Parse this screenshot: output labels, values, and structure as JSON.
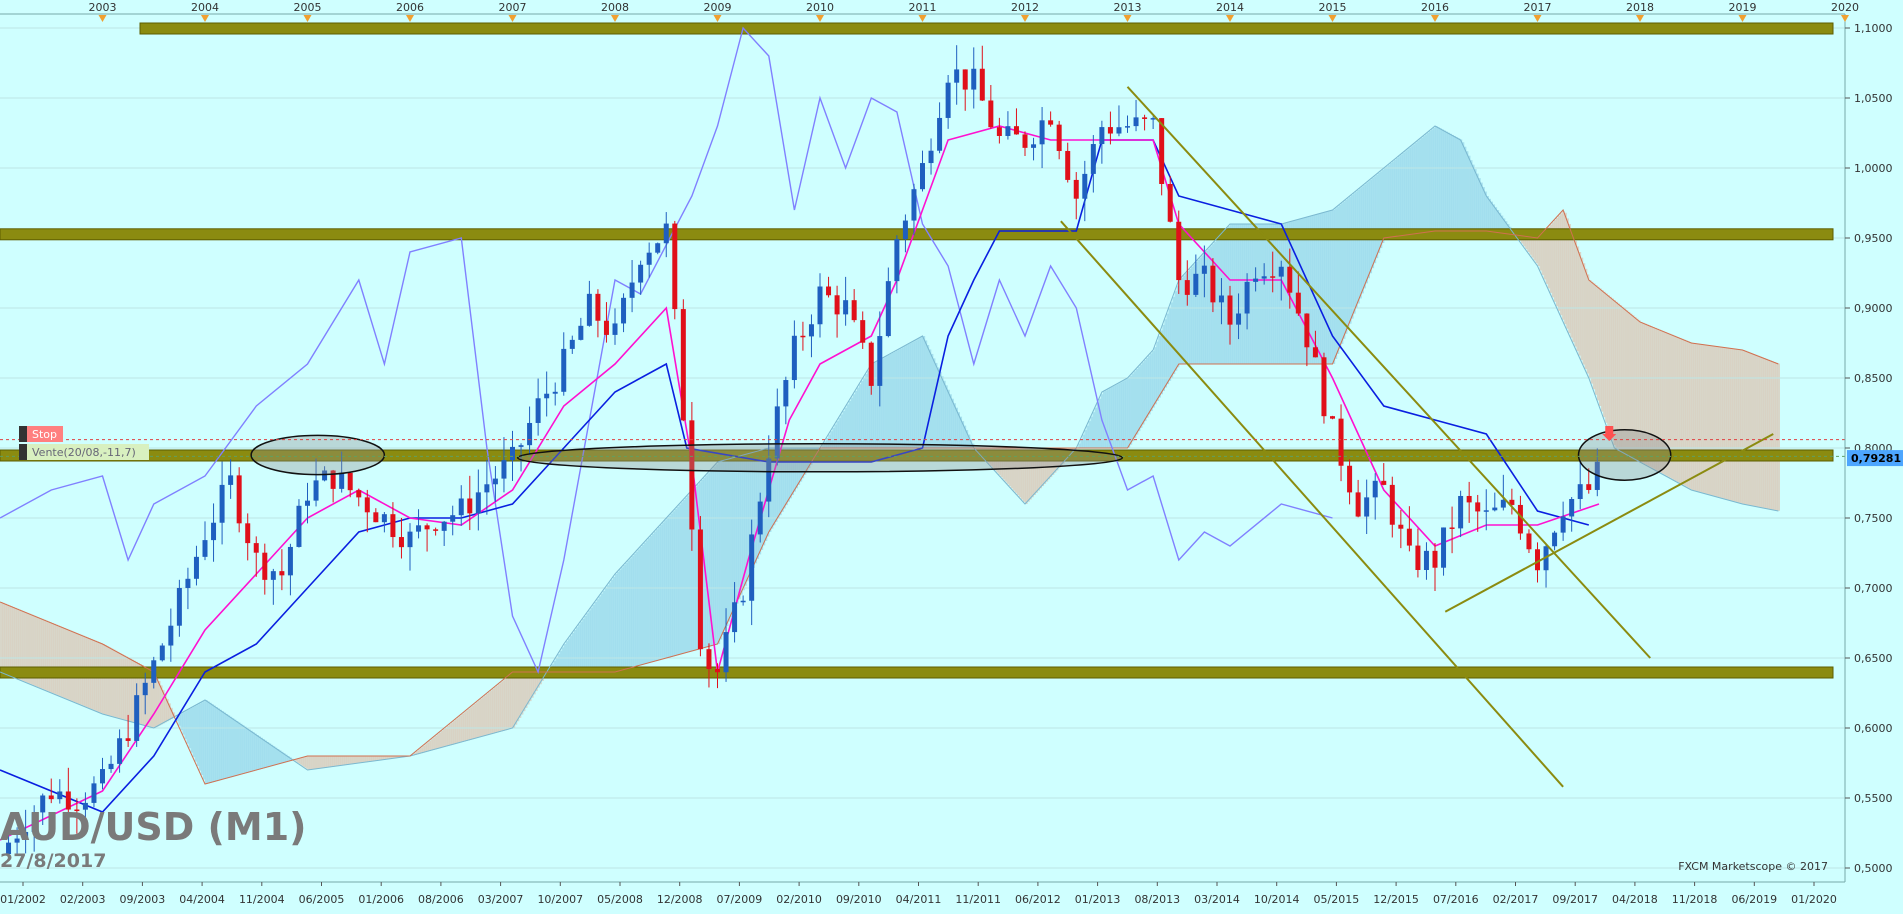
{
  "colors": {
    "background": "#cfffff",
    "bullish": "#1f5fbf",
    "bearish": "#e0101a",
    "band": "#8b8b10",
    "kijun": "#0a1fe0",
    "tenkan": "#ff10d0",
    "chikou": "#8080ff",
    "cloud_bull": "#9fdcec",
    "cloud_bear": "#d9cfc0",
    "trendline": "#8b8b10",
    "price_tag": "#4da6ff"
  },
  "chart_data": {
    "type": "candlestick",
    "instrument": "AUD/USD (M1)",
    "date": "27/8/2017",
    "watermark": "FXCM Marketscope © 2017",
    "y_axis": {
      "range": [
        0.49,
        1.11
      ],
      "ticks": [
        "1,1000",
        "1,0500",
        "1,0000",
        "0,9500",
        "0,9000",
        "0,8500",
        "0,8000",
        "0,7500",
        "0,7000",
        "0,6500",
        "0,6000",
        "0,5500",
        "0,5000"
      ],
      "current_price": "0,79281"
    },
    "top_axis": {
      "years": [
        "2003",
        "2004",
        "2005",
        "2006",
        "2007",
        "2008",
        "2009",
        "2010",
        "2011",
        "2012",
        "2013",
        "2014",
        "2015",
        "2016",
        "2017",
        "2018",
        "2019",
        "2020"
      ]
    },
    "bottom_axis": {
      "dates": [
        "01/2002",
        "02/2003",
        "09/2003",
        "04/2004",
        "11/2004",
        "06/2005",
        "01/2006",
        "08/2006",
        "03/2007",
        "10/2007",
        "05/2008",
        "12/2008",
        "07/2009",
        "02/2010",
        "09/2010",
        "04/2011",
        "11/2011",
        "06/2012",
        "01/2013",
        "08/2013",
        "03/2014",
        "10/2014",
        "05/2015",
        "12/2015",
        "07/2016",
        "02/2017",
        "09/2017",
        "04/2018",
        "11/2018",
        "06/2019",
        "01/2020"
      ]
    },
    "order_labels": {
      "stop": "Stop",
      "sell": "Vente(20/08,-11,7)"
    },
    "horizontal_bands": [
      1.1,
      0.953,
      0.795,
      0.64
    ],
    "trendlines": [
      {
        "x1": 2013.0,
        "y1": 1.058,
        "x2": 2018.1,
        "y2": 0.65
      },
      {
        "x1": 2012.35,
        "y1": 0.962,
        "x2": 2017.25,
        "y2": 0.558
      },
      {
        "x1": 2016.1,
        "y1": 0.683,
        "x2": 2019.3,
        "y2": 0.81
      }
    ],
    "ellipses": [
      {
        "cx": 2005.1,
        "cy": 0.795,
        "rx": 0.65,
        "ry": 0.014
      },
      {
        "cx": 2010.0,
        "cy": 0.793,
        "rx": 2.95,
        "ry": 0.01
      },
      {
        "cx": 2017.85,
        "cy": 0.795,
        "rx": 0.45,
        "ry": 0.018
      }
    ],
    "closes": [
      [
        2002.0,
        0.51
      ],
      [
        2002.25,
        0.535
      ],
      [
        2002.5,
        0.555
      ],
      [
        2002.75,
        0.55
      ],
      [
        2003.0,
        0.56
      ],
      [
        2003.25,
        0.6
      ],
      [
        2003.5,
        0.645
      ],
      [
        2003.75,
        0.69
      ],
      [
        2004.0,
        0.74
      ],
      [
        2004.25,
        0.775
      ],
      [
        2004.5,
        0.72
      ],
      [
        2004.75,
        0.71
      ],
      [
        2005.0,
        0.77
      ],
      [
        2005.25,
        0.78
      ],
      [
        2005.5,
        0.765
      ],
      [
        2005.75,
        0.75
      ],
      [
        2006.0,
        0.735
      ],
      [
        2006.25,
        0.75
      ],
      [
        2006.5,
        0.755
      ],
      [
        2006.75,
        0.775
      ],
      [
        2007.0,
        0.79
      ],
      [
        2007.25,
        0.83
      ],
      [
        2007.5,
        0.86
      ],
      [
        2007.75,
        0.9
      ],
      [
        2008.0,
        0.88
      ],
      [
        2008.25,
        0.94
      ],
      [
        2008.5,
        0.955
      ],
      [
        2008.7,
        0.8
      ],
      [
        2008.85,
        0.65
      ],
      [
        2009.0,
        0.64
      ],
      [
        2009.25,
        0.7
      ],
      [
        2009.5,
        0.8
      ],
      [
        2009.75,
        0.87
      ],
      [
        2010.0,
        0.91
      ],
      [
        2010.25,
        0.9
      ],
      [
        2010.5,
        0.85
      ],
      [
        2010.75,
        0.95
      ],
      [
        2011.0,
        1.0
      ],
      [
        2011.25,
        1.07
      ],
      [
        2011.5,
        1.06
      ],
      [
        2011.75,
        1.02
      ],
      [
        2012.0,
        1.02
      ],
      [
        2012.25,
        1.04
      ],
      [
        2012.5,
        0.98
      ],
      [
        2012.75,
        1.03
      ],
      [
        2013.0,
        1.03
      ],
      [
        2013.25,
        1.03
      ],
      [
        2013.5,
        0.92
      ],
      [
        2013.75,
        0.92
      ],
      [
        2014.0,
        0.89
      ],
      [
        2014.25,
        0.93
      ],
      [
        2014.5,
        0.935
      ],
      [
        2014.75,
        0.88
      ],
      [
        2015.0,
        0.81
      ],
      [
        2015.25,
        0.76
      ],
      [
        2015.5,
        0.77
      ],
      [
        2015.75,
        0.72
      ],
      [
        2016.0,
        0.72
      ],
      [
        2016.25,
        0.76
      ],
      [
        2016.5,
        0.75
      ],
      [
        2016.75,
        0.76
      ],
      [
        2017.0,
        0.72
      ],
      [
        2017.25,
        0.76
      ],
      [
        2017.5,
        0.77
      ],
      [
        2017.65,
        0.79
      ]
    ],
    "tenkan": [
      [
        2002.0,
        0.52
      ],
      [
        2003.0,
        0.555
      ],
      [
        2003.5,
        0.61
      ],
      [
        2004.0,
        0.67
      ],
      [
        2004.5,
        0.71
      ],
      [
        2005.0,
        0.75
      ],
      [
        2005.5,
        0.77
      ],
      [
        2006.0,
        0.75
      ],
      [
        2006.5,
        0.745
      ],
      [
        2007.0,
        0.77
      ],
      [
        2007.5,
        0.83
      ],
      [
        2008.0,
        0.86
      ],
      [
        2008.5,
        0.9
      ],
      [
        2008.75,
        0.79
      ],
      [
        2009.0,
        0.64
      ],
      [
        2009.3,
        0.72
      ],
      [
        2009.7,
        0.82
      ],
      [
        2010.0,
        0.86
      ],
      [
        2010.5,
        0.88
      ],
      [
        2010.75,
        0.92
      ],
      [
        2011.0,
        0.97
      ],
      [
        2011.25,
        1.02
      ],
      [
        2011.75,
        1.03
      ],
      [
        2012.25,
        1.02
      ],
      [
        2012.75,
        1.02
      ],
      [
        2013.25,
        1.02
      ],
      [
        2013.5,
        0.96
      ],
      [
        2014.0,
        0.92
      ],
      [
        2014.5,
        0.92
      ],
      [
        2015.0,
        0.85
      ],
      [
        2015.5,
        0.77
      ],
      [
        2016.0,
        0.73
      ],
      [
        2016.5,
        0.745
      ],
      [
        2017.0,
        0.745
      ],
      [
        2017.6,
        0.76
      ]
    ],
    "kijun": [
      [
        2002.0,
        0.57
      ],
      [
        2003.0,
        0.54
      ],
      [
        2003.5,
        0.58
      ],
      [
        2004.0,
        0.64
      ],
      [
        2004.5,
        0.66
      ],
      [
        2005.0,
        0.7
      ],
      [
        2005.5,
        0.74
      ],
      [
        2006.0,
        0.75
      ],
      [
        2006.5,
        0.75
      ],
      [
        2007.0,
        0.76
      ],
      [
        2007.5,
        0.8
      ],
      [
        2008.0,
        0.84
      ],
      [
        2008.5,
        0.86
      ],
      [
        2008.7,
        0.8
      ],
      [
        2009.5,
        0.79
      ],
      [
        2010.0,
        0.79
      ],
      [
        2010.5,
        0.79
      ],
      [
        2011.0,
        0.8
      ],
      [
        2011.25,
        0.88
      ],
      [
        2011.5,
        0.92
      ],
      [
        2011.75,
        0.955
      ],
      [
        2012.5,
        0.955
      ],
      [
        2012.75,
        1.02
      ],
      [
        2013.25,
        1.02
      ],
      [
        2013.5,
        0.98
      ],
      [
        2014.0,
        0.97
      ],
      [
        2014.5,
        0.96
      ],
      [
        2015.0,
        0.88
      ],
      [
        2015.5,
        0.83
      ],
      [
        2016.0,
        0.82
      ],
      [
        2016.5,
        0.81
      ],
      [
        2017.0,
        0.755
      ],
      [
        2017.5,
        0.745
      ]
    ],
    "chikou": [
      [
        2002.0,
        0.75
      ],
      [
        2002.5,
        0.77
      ],
      [
        2003.0,
        0.78
      ],
      [
        2003.25,
        0.72
      ],
      [
        2003.5,
        0.76
      ],
      [
        2004.0,
        0.78
      ],
      [
        2004.5,
        0.83
      ],
      [
        2005.0,
        0.86
      ],
      [
        2005.5,
        0.92
      ],
      [
        2005.75,
        0.86
      ],
      [
        2006.0,
        0.94
      ],
      [
        2006.5,
        0.95
      ],
      [
        2006.75,
        0.8
      ],
      [
        2007.0,
        0.68
      ],
      [
        2007.25,
        0.64
      ],
      [
        2007.5,
        0.72
      ],
      [
        2007.75,
        0.82
      ],
      [
        2008.0,
        0.92
      ],
      [
        2008.25,
        0.91
      ],
      [
        2008.75,
        0.98
      ],
      [
        2009.0,
        1.03
      ],
      [
        2009.25,
        1.1
      ],
      [
        2009.5,
        1.08
      ],
      [
        2009.75,
        0.97
      ],
      [
        2010.0,
        1.05
      ],
      [
        2010.25,
        1.0
      ],
      [
        2010.5,
        1.05
      ],
      [
        2010.75,
        1.04
      ],
      [
        2011.0,
        0.96
      ],
      [
        2011.25,
        0.93
      ],
      [
        2011.5,
        0.86
      ],
      [
        2011.75,
        0.92
      ],
      [
        2012.0,
        0.88
      ],
      [
        2012.25,
        0.93
      ],
      [
        2012.5,
        0.9
      ],
      [
        2012.75,
        0.82
      ],
      [
        2013.0,
        0.77
      ],
      [
        2013.25,
        0.78
      ],
      [
        2013.5,
        0.72
      ],
      [
        2013.75,
        0.74
      ],
      [
        2014.0,
        0.73
      ],
      [
        2014.5,
        0.76
      ],
      [
        2015.0,
        0.75
      ]
    ],
    "senkou_a": [
      [
        2002.0,
        0.64
      ],
      [
        2003.0,
        0.61
      ],
      [
        2003.5,
        0.6
      ],
      [
        2004.0,
        0.62
      ],
      [
        2005.0,
        0.57
      ],
      [
        2006.0,
        0.58
      ],
      [
        2007.0,
        0.6
      ],
      [
        2007.5,
        0.66
      ],
      [
        2008.0,
        0.71
      ],
      [
        2008.5,
        0.75
      ],
      [
        2009.0,
        0.79
      ],
      [
        2009.5,
        0.8
      ],
      [
        2010.0,
        0.8
      ],
      [
        2010.5,
        0.86
      ],
      [
        2011.0,
        0.88
      ],
      [
        2011.5,
        0.8
      ],
      [
        2012.0,
        0.76
      ],
      [
        2012.5,
        0.8
      ],
      [
        2012.75,
        0.84
      ],
      [
        2013.0,
        0.85
      ],
      [
        2013.25,
        0.87
      ],
      [
        2013.5,
        0.92
      ],
      [
        2014.0,
        0.96
      ],
      [
        2014.5,
        0.96
      ],
      [
        2015.0,
        0.97
      ],
      [
        2015.5,
        1.0
      ],
      [
        2016.0,
        1.03
      ],
      [
        2016.25,
        1.02
      ],
      [
        2016.5,
        0.98
      ],
      [
        2017.0,
        0.93
      ],
      [
        2017.5,
        0.85
      ],
      [
        2017.75,
        0.8
      ],
      [
        2018.0,
        0.79
      ],
      [
        2018.5,
        0.77
      ],
      [
        2019.0,
        0.76
      ],
      [
        2019.35,
        0.755
      ]
    ],
    "senkou_b": [
      [
        2002.0,
        0.69
      ],
      [
        2003.0,
        0.66
      ],
      [
        2003.5,
        0.64
      ],
      [
        2004.0,
        0.56
      ],
      [
        2005.0,
        0.58
      ],
      [
        2006.0,
        0.58
      ],
      [
        2007.0,
        0.64
      ],
      [
        2008.0,
        0.64
      ],
      [
        2008.5,
        0.65
      ],
      [
        2009.0,
        0.66
      ],
      [
        2009.5,
        0.74
      ],
      [
        2010.0,
        0.8
      ],
      [
        2010.5,
        0.8
      ],
      [
        2011.0,
        0.8
      ],
      [
        2011.5,
        0.8
      ],
      [
        2012.0,
        0.8
      ],
      [
        2012.5,
        0.8
      ],
      [
        2013.0,
        0.8
      ],
      [
        2013.5,
        0.86
      ],
      [
        2014.0,
        0.86
      ],
      [
        2014.5,
        0.86
      ],
      [
        2015.0,
        0.86
      ],
      [
        2015.5,
        0.95
      ],
      [
        2016.0,
        0.955
      ],
      [
        2016.5,
        0.955
      ],
      [
        2017.0,
        0.95
      ],
      [
        2017.25,
        0.97
      ],
      [
        2017.5,
        0.92
      ],
      [
        2018.0,
        0.89
      ],
      [
        2018.5,
        0.875
      ],
      [
        2019.0,
        0.87
      ],
      [
        2019.35,
        0.86
      ]
    ]
  }
}
